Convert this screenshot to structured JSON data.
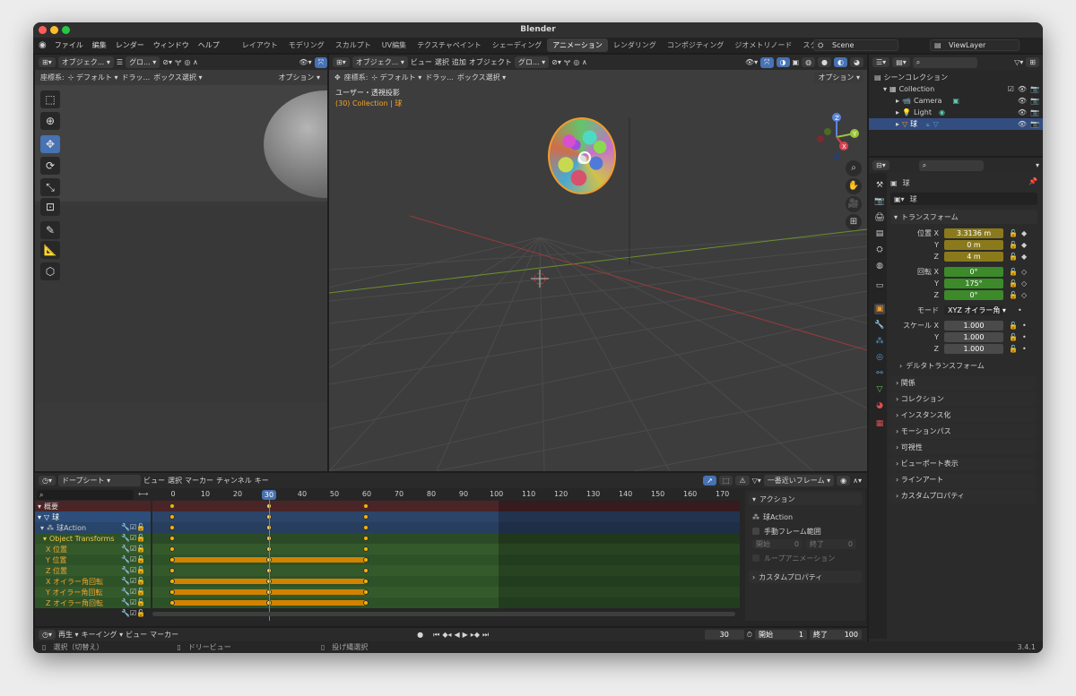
{
  "app": {
    "title": "Blender",
    "version": "3.4.1"
  },
  "menu": {
    "items": [
      "ファイル",
      "編集",
      "レンダー",
      "ウィンドウ",
      "ヘルプ"
    ]
  },
  "workspaces": {
    "tabs": [
      "レイアウト",
      "モデリング",
      "スカルプト",
      "UV編集",
      "テクスチャペイント",
      "シェーディング",
      "アニメーション",
      "レンダリング",
      "コンポジティング",
      "ジオメトリノード",
      "スクリプト作成"
    ],
    "active": "アニメーション"
  },
  "scene": {
    "name": "Scene",
    "view_layer": "ViewLayer"
  },
  "camera_view": {
    "header_mode": "オブジェク...",
    "header_view": "グロ...",
    "coord_label": "座標系:",
    "coord_value": "デフォルト",
    "drag_label": "ドラッ...",
    "select_mode": "ボックス選択",
    "options": "オプション"
  },
  "viewport": {
    "mode": "オブジェク...",
    "menus": [
      "ビュー",
      "選択",
      "追加",
      "オブジェクト"
    ],
    "transform_orient": "グロ...",
    "coord_label": "座標系:",
    "coord_value": "デフォルト",
    "drag_label": "ドラッ...",
    "select_mode": "ボックス選択",
    "options": "オプション",
    "view_name": "ユーザー・透視投影",
    "collection_info": "(30) Collection | 球",
    "axes": {
      "x": "X",
      "y": "Y",
      "z": "Z"
    }
  },
  "outliner": {
    "scene_collection": "シーンコレクション",
    "items": [
      {
        "label": "Collection",
        "level": 1
      },
      {
        "label": "Camera",
        "level": 2
      },
      {
        "label": "Light",
        "level": 2
      },
      {
        "label": "球",
        "level": 2,
        "selected": true
      }
    ]
  },
  "properties": {
    "object_name": "球",
    "data_name": "球",
    "transform_title": "トランスフォーム",
    "location": {
      "label": "位置",
      "x": "3.3136 m",
      "y": "0 m",
      "z": "4 m"
    },
    "rotation": {
      "label": "回転",
      "x": "0°",
      "y": "175°",
      "z": "0°"
    },
    "mode": {
      "label": "モード",
      "value": "XYZ オイラー角"
    },
    "scale": {
      "label": "スケール",
      "x": "1.000",
      "y": "1.000",
      "z": "1.000"
    },
    "axis_labels": {
      "x": "X",
      "y": "Y",
      "z": "Z"
    },
    "delta_transform": "デルタトランスフォーム",
    "sections": [
      "関係",
      "コレクション",
      "インスタンス化",
      "モーションパス",
      "可視性",
      "ビューポート表示",
      "ラインアート",
      "カスタムプロパティ"
    ]
  },
  "dopesheet": {
    "mode": "ドープシート",
    "menus": [
      "ビュー",
      "選択",
      "マーカー",
      "チャンネル",
      "キー"
    ],
    "snap": "一番近いフレーム",
    "ruler": [
      0,
      10,
      20,
      30,
      40,
      50,
      60,
      70,
      80,
      90,
      100,
      110,
      120,
      130,
      140,
      150,
      160,
      170
    ],
    "current_frame": 30,
    "keyframes": [
      0,
      30,
      60
    ],
    "channels": [
      {
        "label": "概要",
        "kind": "summary"
      },
      {
        "label": "球",
        "kind": "object"
      },
      {
        "label": "球Action",
        "kind": "action"
      },
      {
        "label": "Object Transforms",
        "kind": "group"
      },
      {
        "label": "X 位置",
        "kind": "fcurve"
      },
      {
        "label": "Y 位置",
        "kind": "fcurve",
        "hold": true
      },
      {
        "label": "Z 位置",
        "kind": "fcurve"
      },
      {
        "label": "X オイラー角回転",
        "kind": "fcurve",
        "hold": true
      },
      {
        "label": "Y オイラー角回転",
        "kind": "fcurve",
        "hold": true
      },
      {
        "label": "Z オイラー角回転",
        "kind": "fcurve",
        "hold": true
      }
    ],
    "side_panel": {
      "action_title": "アクション",
      "action_name": "球Action",
      "manual_frame_range": "手動フレーム範囲",
      "start_label": "開始",
      "start_value": "0",
      "end_label": "終了",
      "end_value": "0",
      "loop_anim": "ループアニメーション",
      "custom_props": "カスタムプロパティ"
    }
  },
  "timeline": {
    "menus": [
      "再生",
      "キーイング",
      "ビュー",
      "マーカー"
    ],
    "frame": "30",
    "start_label": "開始",
    "start_value": "1",
    "end_label": "終了",
    "end_value": "100"
  },
  "statusbar": {
    "select": "選択（切替え）",
    "dolly": "ドリービュー",
    "lasso": "投げ縄選択",
    "version": "3.4.1"
  },
  "colors": {
    "accent": "#4772b3",
    "keyframe": "#f5b400",
    "selection": "#f19c2c",
    "location_field": "#8a7a1c",
    "rotation_field": "#3c8a2a"
  }
}
